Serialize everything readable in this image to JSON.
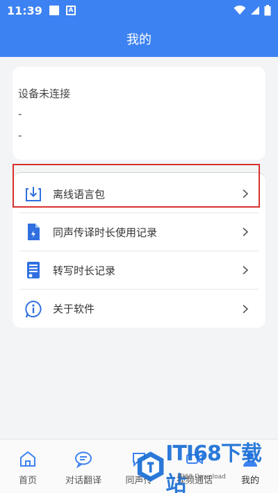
{
  "status_bar": {
    "time": "11:39",
    "notif_a": "A"
  },
  "header": {
    "title": "我的"
  },
  "device": {
    "status": "设备未连接",
    "line1": "-",
    "line2": "-"
  },
  "menu": {
    "items": [
      {
        "label": "离线语言包",
        "icon": "download-icon"
      },
      {
        "label": "同声传译时长使用记录",
        "icon": "document-icon"
      },
      {
        "label": "转写时长记录",
        "icon": "transcript-icon"
      },
      {
        "label": "关于软件",
        "icon": "info-icon"
      }
    ]
  },
  "bottom_nav": {
    "items": [
      {
        "label": "首页",
        "icon": "home-icon"
      },
      {
        "label": "对话翻译",
        "icon": "chat-icon"
      },
      {
        "label": "同声传",
        "icon": "simultaneous-icon"
      },
      {
        "label": "视频通话",
        "icon": "video-call-icon"
      },
      {
        "label": "我的",
        "icon": "profile-icon"
      }
    ]
  },
  "watermark": {
    "text": "ITI68下载站",
    "sub": "ITI68 Download"
  },
  "colors": {
    "primary": "#3d82f2",
    "highlight": "#d9302c",
    "icon": "#2f6fe0"
  }
}
